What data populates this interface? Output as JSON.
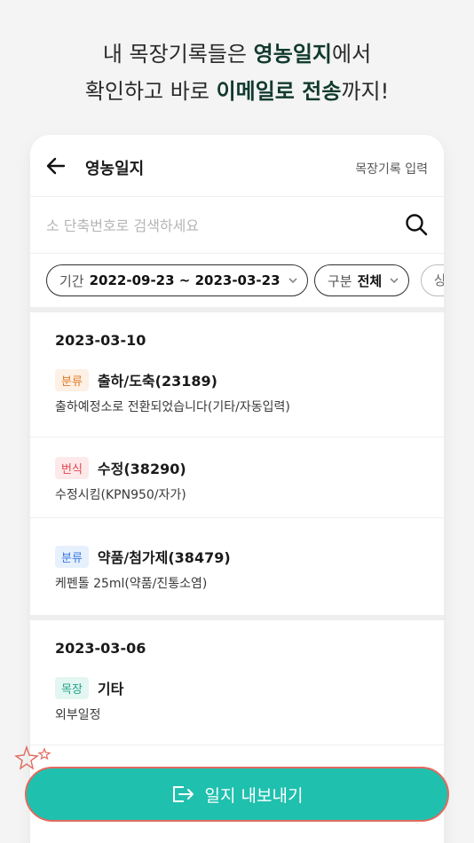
{
  "headline": {
    "line1_pre": "내 목장기록들은 ",
    "line1_bold": "영농일지",
    "line1_post": "에서",
    "line2_pre": "확인하고 바로 ",
    "line2_bold": "이메일로 전송",
    "line2_post": "까지!"
  },
  "header": {
    "title": "영농일지",
    "action_link": "목장기록 입력"
  },
  "search": {
    "placeholder": "소 단축번호로 검색하세요"
  },
  "filters": {
    "period_label": "기간",
    "period_value": "2022-09-23 ~ 2023-03-23",
    "category_label": "구분",
    "category_value": "전체",
    "more_label": "상"
  },
  "groups": [
    {
      "date": "2023-03-10",
      "entries": [
        {
          "tag": "분류",
          "tag_color": "#e07b28",
          "title": "출하/도축(23189)",
          "desc": "출하예정소로 전환되었습니다(기타/자동입력)"
        },
        {
          "tag": "번식",
          "tag_color": "#e0464f",
          "title": "수정(38290)",
          "desc": "수정시킴(KPN950/자가)"
        },
        {
          "tag": "분류",
          "tag_color": "#3a7be0",
          "title": "약품/첨가제(38479)",
          "desc": "케펜톨 25ml(약품/진통소염)"
        }
      ]
    },
    {
      "date": "2023-03-06",
      "entries": [
        {
          "tag": "목장",
          "tag_color": "#22a48a",
          "title": "기타",
          "desc": "외부일정"
        }
      ]
    }
  ],
  "export_button": {
    "label": "일지 내보내기"
  },
  "colors": {
    "accent": "#20c0ae",
    "dark_green": "#123a2f"
  }
}
